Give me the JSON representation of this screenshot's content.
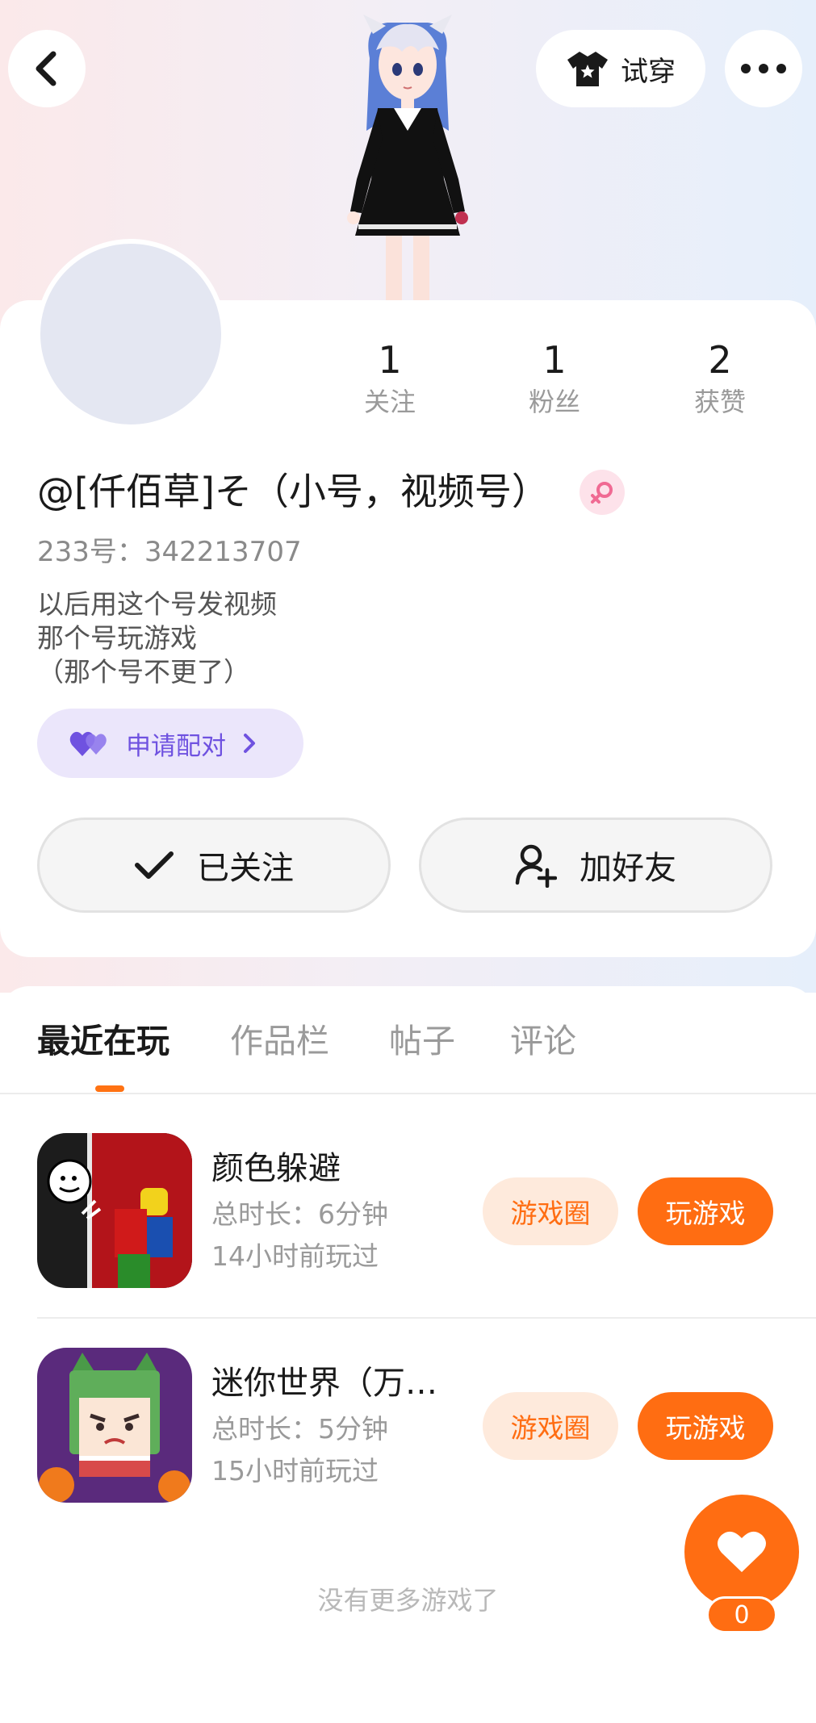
{
  "header": {
    "tryon_label": "试穿"
  },
  "profile": {
    "stats": [
      {
        "value": "1",
        "label": "关注"
      },
      {
        "value": "1",
        "label": "粉丝"
      },
      {
        "value": "2",
        "label": "获赞"
      }
    ],
    "nickname": "@[仟佰草]そ（小号，视频号）",
    "uid": "233号：342213707",
    "bio": [
      "以后用这个号发视频",
      "那个号玩游戏",
      "（那个号不更了）"
    ],
    "match_label": "申请配对",
    "follow_label": "已关注",
    "add_friend_label": "加好友"
  },
  "tabs": [
    {
      "label": "最近在玩"
    },
    {
      "label": "作品栏"
    },
    {
      "label": "帖子"
    },
    {
      "label": "评论"
    }
  ],
  "games": [
    {
      "name": "颜色躲避",
      "duration": "总时长：6分钟",
      "last_played": "14小时前玩过",
      "circle_label": "游戏圈",
      "play_label": "玩游戏"
    },
    {
      "name": "迷你世界（万…",
      "duration": "总时长：5分钟",
      "last_played": "15小时前玩过",
      "circle_label": "游戏圈",
      "play_label": "玩游戏"
    }
  ],
  "footer": {
    "no_more": "没有更多游戏了"
  },
  "like": {
    "count": "0"
  },
  "colors": {
    "accent": "#ff6d12",
    "match_purple": "#6f52e0",
    "gender_pink": "#f06a93"
  }
}
